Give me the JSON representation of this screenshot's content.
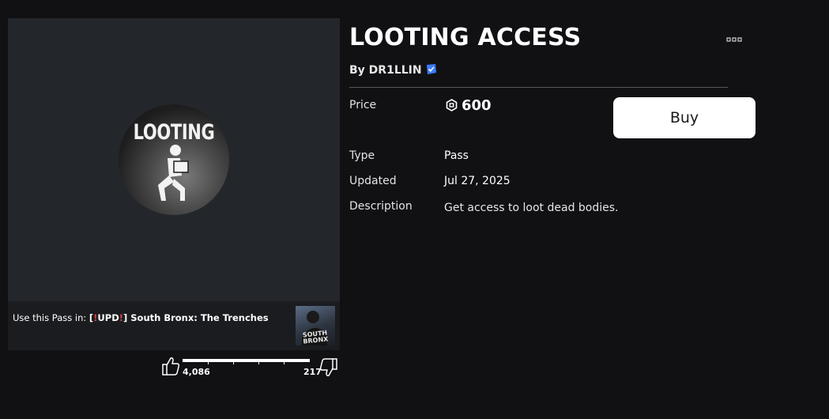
{
  "item": {
    "title": "LOOTING ACCESS",
    "creator_prefix": "By",
    "creator_name": "DR1LLIN",
    "thumbnail_text": "LOOTING"
  },
  "details": {
    "price_label": "Price",
    "price_value": "600",
    "type_label": "Type",
    "type_value": "Pass",
    "updated_label": "Updated",
    "updated_value": "Jul 27, 2025",
    "description_label": "Description",
    "description_value": "Get access to loot dead bodies."
  },
  "buy_button": {
    "label": "Buy"
  },
  "game_link": {
    "prefix": "Use this Pass in:",
    "open_bracket": "[",
    "bang1": "!",
    "upd": "UPD",
    "bang2": "!",
    "close_bracket": "]",
    "game_name": "South Bronx: The Trenches",
    "thumb_text_line1": "SOUTH",
    "thumb_text_line2": "BRONX"
  },
  "votes": {
    "up": "4,086",
    "down": "217"
  },
  "colors": {
    "background": "#111114",
    "panel": "#23262b",
    "verified_badge": "#3b7cff",
    "accent_red": "#e04040",
    "buy_button_bg": "#ffffff"
  },
  "icons": {
    "more": "more-horizontal-icon",
    "verified": "verified-badge-icon",
    "robux": "robux-icon",
    "thumbs_up": "thumbs-up-icon",
    "thumbs_down": "thumbs-down-icon"
  }
}
